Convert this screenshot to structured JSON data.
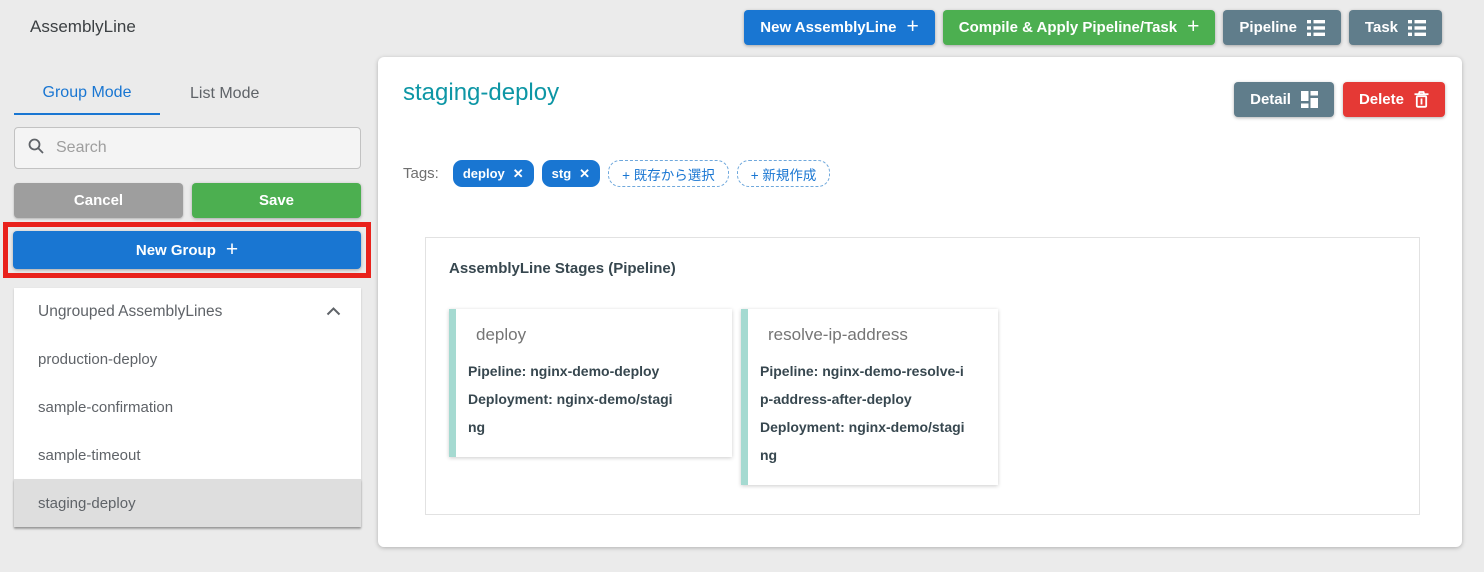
{
  "app": {
    "title": "AssemblyLine"
  },
  "toolbar": {
    "new_assemblyline": "New AssemblyLine",
    "compile_apply": "Compile & Apply Pipeline/Task",
    "pipeline": "Pipeline",
    "task": "Task"
  },
  "icons": {
    "plus": "+",
    "close": "✕"
  },
  "sidebar": {
    "tabs": {
      "group_mode": "Group Mode",
      "list_mode": "List Mode"
    },
    "search_placeholder": "Search",
    "cancel": "Cancel",
    "save": "Save",
    "new_group": "New Group",
    "group_header": "Ungrouped AssemblyLines",
    "items": [
      "production-deploy",
      "sample-confirmation",
      "sample-timeout",
      "staging-deploy"
    ],
    "selected_item": "staging-deploy"
  },
  "main": {
    "title": "staging-deploy",
    "detail": "Detail",
    "delete": "Delete",
    "tags": {
      "label": "Tags:",
      "items": [
        {
          "label": "deploy"
        },
        {
          "label": "stg"
        }
      ],
      "add_existing": "+ 既存から選択",
      "add_new": "+ 新規作成"
    },
    "stages_header": "AssemblyLine Stages (Pipeline)",
    "stages": [
      {
        "name": "deploy",
        "pipeline": "Pipeline: nginx-demo-deploy",
        "deployment": "Deployment: nginx-demo/staging"
      },
      {
        "name": "resolve-ip-address",
        "pipeline": "Pipeline: nginx-demo-resolve-ip-address-after-deploy",
        "deployment": "Deployment: nginx-demo/staging"
      }
    ]
  },
  "colors": {
    "accent_blue": "#1976d2",
    "green": "#4caf50",
    "slate": "#607d8b",
    "delete_red": "#e53935",
    "annotation_red": "#e9221c",
    "title_teal": "#0d96a5",
    "stage_strip_teal": "#a5dad1",
    "background": "#ebebeb"
  }
}
